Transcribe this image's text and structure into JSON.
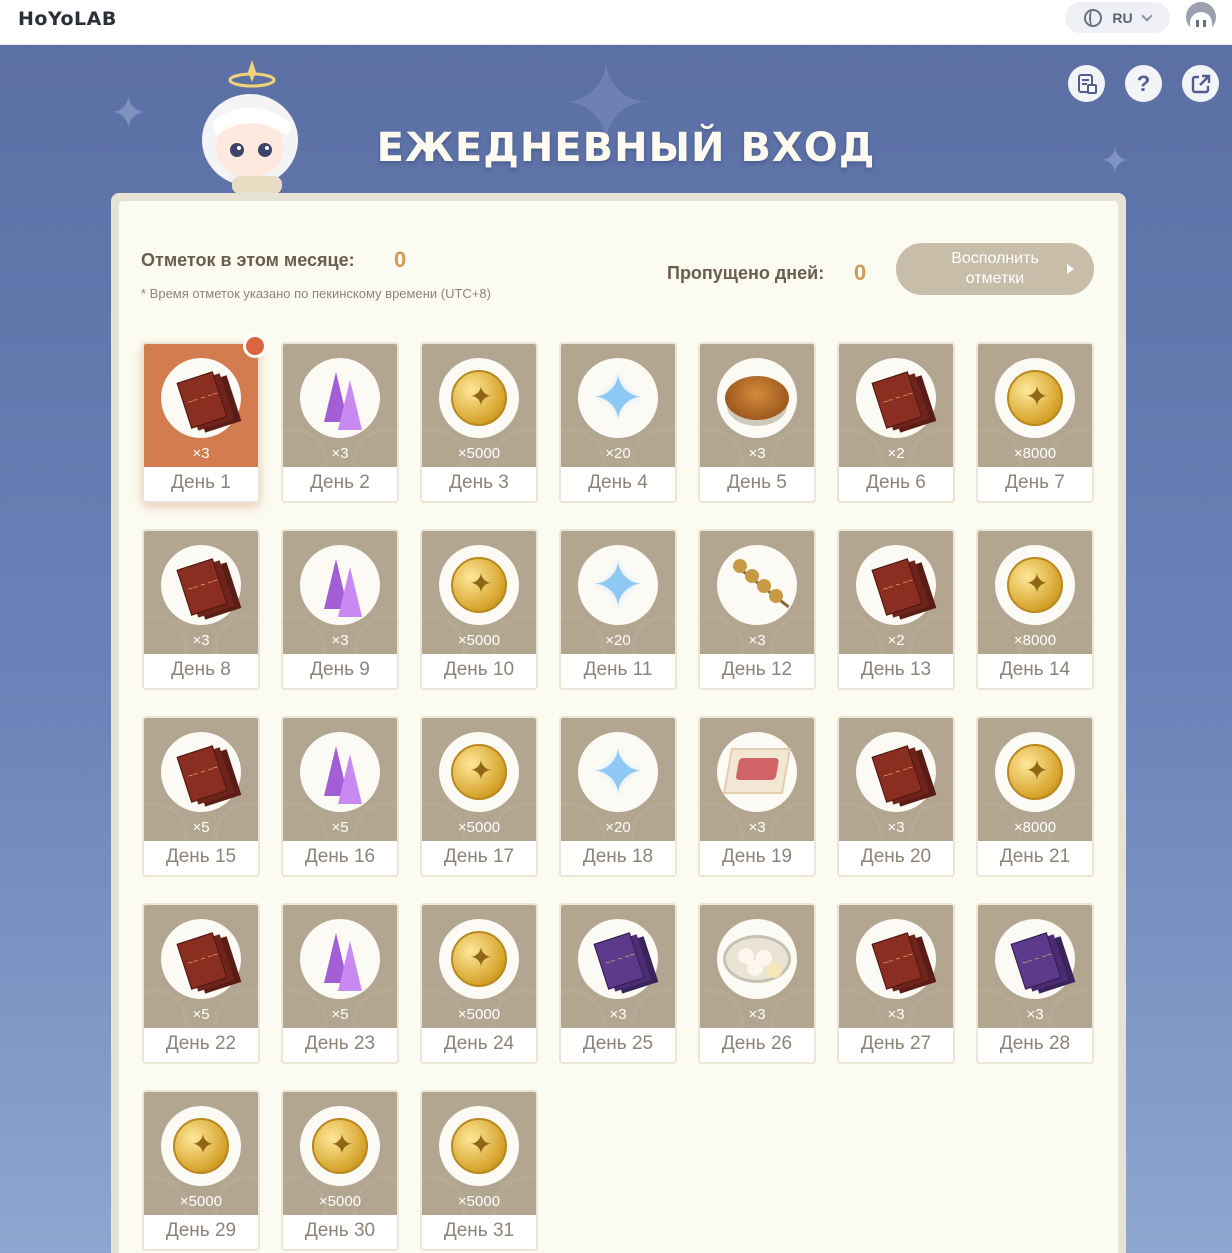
{
  "header": {
    "logo": "HoYoLAB",
    "language": "RU"
  },
  "hero": {
    "title": "ЕЖЕДНЕВНЫЙ ВХОД"
  },
  "stats": {
    "checkins_label": "Отметок в этом месяце:",
    "checkins_value": "0",
    "missed_label": "Пропущено дней:",
    "missed_value": "0",
    "note": "* Время отметок указано по пекинскому времени (UTC+8)",
    "fill_button": "Восполнить отметки"
  },
  "rewards": [
    {
      "day": "День 1",
      "qty": "×3",
      "item": "book",
      "active": true
    },
    {
      "day": "День 2",
      "qty": "×3",
      "item": "crystal"
    },
    {
      "day": "День 3",
      "qty": "×5000",
      "item": "coin"
    },
    {
      "day": "День 4",
      "qty": "×20",
      "item": "star"
    },
    {
      "day": "День 5",
      "qty": "×3",
      "item": "food"
    },
    {
      "day": "День 6",
      "qty": "×2",
      "item": "book"
    },
    {
      "day": "День 7",
      "qty": "×8000",
      "item": "coin"
    },
    {
      "day": "День 8",
      "qty": "×3",
      "item": "book"
    },
    {
      "day": "День 9",
      "qty": "×3",
      "item": "crystal"
    },
    {
      "day": "День 10",
      "qty": "×5000",
      "item": "coin"
    },
    {
      "day": "День 11",
      "qty": "×20",
      "item": "star"
    },
    {
      "day": "День 12",
      "qty": "×3",
      "item": "skewer"
    },
    {
      "day": "День 13",
      "qty": "×2",
      "item": "book"
    },
    {
      "day": "День 14",
      "qty": "×8000",
      "item": "coin"
    },
    {
      "day": "День 15",
      "qty": "×5",
      "item": "book"
    },
    {
      "day": "День 16",
      "qty": "×5",
      "item": "crystal"
    },
    {
      "day": "День 17",
      "qty": "×5000",
      "item": "coin"
    },
    {
      "day": "День 18",
      "qty": "×20",
      "item": "star"
    },
    {
      "day": "День 19",
      "qty": "×3",
      "item": "toast"
    },
    {
      "day": "День 20",
      "qty": "×3",
      "item": "book"
    },
    {
      "day": "День 21",
      "qty": "×8000",
      "item": "coin"
    },
    {
      "day": "День 22",
      "qty": "×5",
      "item": "book"
    },
    {
      "day": "День 23",
      "qty": "×5",
      "item": "crystal"
    },
    {
      "day": "День 24",
      "qty": "×5000",
      "item": "coin"
    },
    {
      "day": "День 25",
      "qty": "×3",
      "item": "book-purple"
    },
    {
      "day": "День 26",
      "qty": "×3",
      "item": "dumplings"
    },
    {
      "day": "День 27",
      "qty": "×3",
      "item": "book"
    },
    {
      "day": "День 28",
      "qty": "×3",
      "item": "book-purple"
    },
    {
      "day": "День 29",
      "qty": "×5000",
      "item": "coin"
    },
    {
      "day": "День 30",
      "qty": "×5000",
      "item": "coin"
    },
    {
      "day": "День 31",
      "qty": "×5000",
      "item": "coin"
    }
  ]
}
